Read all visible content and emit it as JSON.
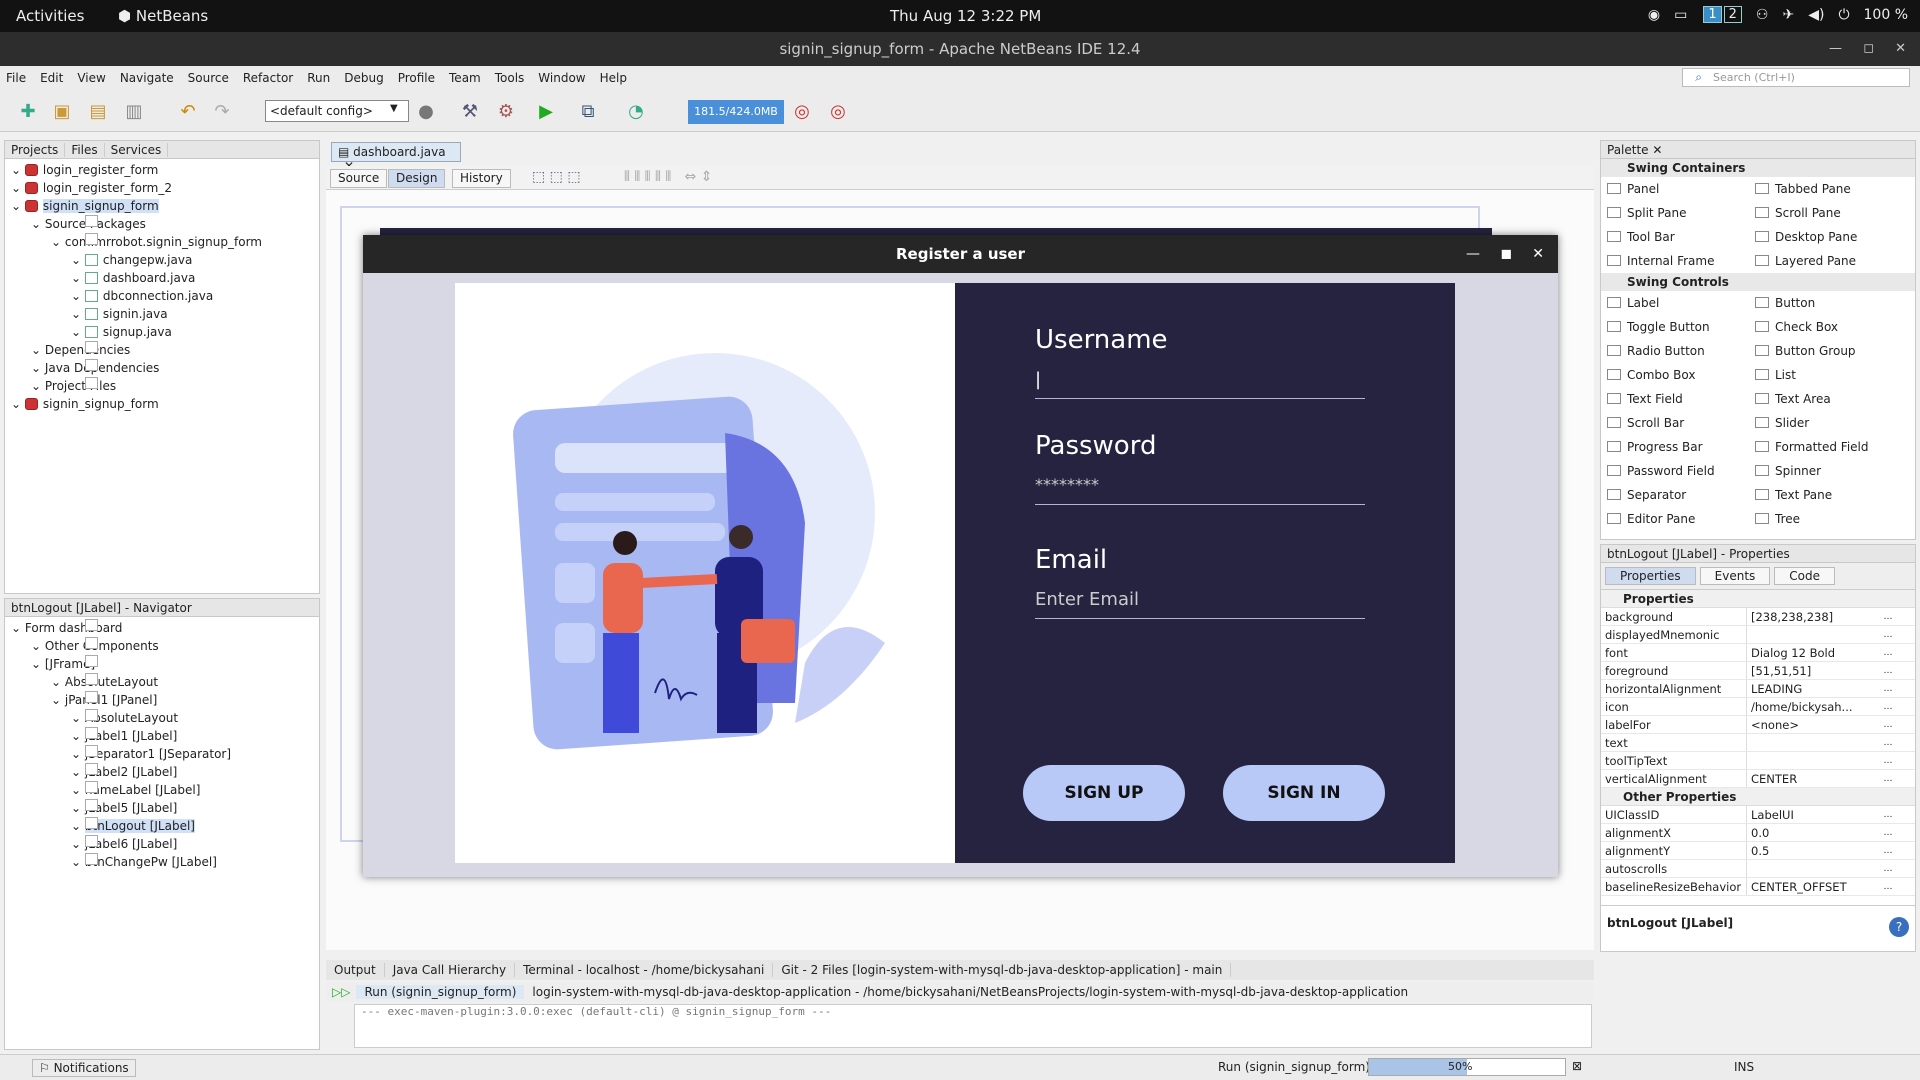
{
  "topbar": {
    "activities": "Activities",
    "app": "NetBeans",
    "clock": "Thu Aug 12   3:22 PM",
    "ws1": "1",
    "ws2": "2",
    "battery": "100 %"
  },
  "window": {
    "title": "signin_signup_form - Apache NetBeans IDE 12.4"
  },
  "menu": [
    "File",
    "Edit",
    "View",
    "Navigate",
    "Source",
    "Refactor",
    "Run",
    "Debug",
    "Profile",
    "Team",
    "Tools",
    "Window",
    "Help"
  ],
  "search": {
    "placeholder": "Search (Ctrl+I)"
  },
  "toolbar": {
    "config": "<default config>",
    "memory": "181.5/424.0MB"
  },
  "projects": {
    "tabs": [
      "Projects",
      "Files",
      "Services"
    ],
    "tree": [
      {
        "label": "login_register_form",
        "depth": 0,
        "icon": "proj"
      },
      {
        "label": "login_register_form_2",
        "depth": 0,
        "icon": "proj"
      },
      {
        "label": "signin_signup_form",
        "depth": 0,
        "icon": "proj",
        "selected": true
      },
      {
        "label": "Source Packages",
        "depth": 1,
        "icon": "pkg"
      },
      {
        "label": "com.mrrobot.signin_signup_form",
        "depth": 2,
        "icon": "pkg"
      },
      {
        "label": "changepw.java",
        "depth": 3,
        "icon": "java"
      },
      {
        "label": "dashboard.java",
        "depth": 3,
        "icon": "java"
      },
      {
        "label": "dbconnection.java",
        "depth": 3,
        "icon": "java"
      },
      {
        "label": "signin.java",
        "depth": 3,
        "icon": "java"
      },
      {
        "label": "signup.java",
        "depth": 3,
        "icon": "java"
      },
      {
        "label": "Dependencies",
        "depth": 1,
        "icon": "pkg"
      },
      {
        "label": "Java Dependencies",
        "depth": 1,
        "icon": "pkg"
      },
      {
        "label": "Project Files",
        "depth": 1,
        "icon": "pkg"
      },
      {
        "label": "signin_signup_form",
        "depth": 0,
        "icon": "proj"
      }
    ]
  },
  "navigator": {
    "title": "btnLogout [JLabel] - Navigator",
    "tree": [
      {
        "label": "Form dashboard",
        "depth": 0
      },
      {
        "label": "Other Components",
        "depth": 1
      },
      {
        "label": "[JFrame]",
        "depth": 1
      },
      {
        "label": "AbsoluteLayout",
        "depth": 2
      },
      {
        "label": "jPanel1 [JPanel]",
        "depth": 2
      },
      {
        "label": "AbsoluteLayout",
        "depth": 3
      },
      {
        "label": "jLabel1 [JLabel]",
        "depth": 3
      },
      {
        "label": "jSeparator1 [JSeparator]",
        "depth": 3
      },
      {
        "label": "jLabel2 [JLabel]",
        "depth": 3
      },
      {
        "label": "nameLabel [JLabel]",
        "depth": 3
      },
      {
        "label": "jLabel5 [JLabel]",
        "depth": 3
      },
      {
        "label": "btnLogout [JLabel]",
        "depth": 3,
        "selected": true
      },
      {
        "label": "jLabel6 [JLabel]",
        "depth": 3
      },
      {
        "label": "btnChangePw [JLabel]",
        "depth": 3
      }
    ]
  },
  "editor": {
    "tab": "dashboard.java",
    "views": [
      "Source",
      "Design",
      "History"
    ]
  },
  "form": {
    "title": "Register a user",
    "username_label": "Username",
    "username_value": "",
    "password_label": "Password",
    "password_value": "********",
    "email_label": "Email",
    "email_placeholder": "Enter Email",
    "signup": "SIGN UP",
    "signin": "SIGN IN"
  },
  "palette": {
    "title": "Palette",
    "containers_title": "Swing Containers",
    "containers": [
      "Panel",
      "Tabbed Pane",
      "Split Pane",
      "Scroll Pane",
      "Tool Bar",
      "Desktop Pane",
      "Internal Frame",
      "Layered Pane"
    ],
    "controls_title": "Swing Controls",
    "controls": [
      "Label",
      "Button",
      "Toggle Button",
      "Check Box",
      "Radio Button",
      "Button Group",
      "Combo Box",
      "List",
      "Text Field",
      "Text Area",
      "Scroll Bar",
      "Slider",
      "Progress Bar",
      "Formatted Field",
      "Password Field",
      "Spinner",
      "Separator",
      "Text Pane",
      "Editor Pane",
      "Tree"
    ]
  },
  "properties": {
    "title": "btnLogout [JLabel] - Properties",
    "tabs": [
      "Properties",
      "Events",
      "Code"
    ],
    "section1": "Properties",
    "rows": [
      {
        "k": "background",
        "v": "[238,238,238]"
      },
      {
        "k": "displayedMnemonic",
        "v": ""
      },
      {
        "k": "font",
        "v": "Dialog 12 Bold"
      },
      {
        "k": "foreground",
        "v": "[51,51,51]"
      },
      {
        "k": "horizontalAlignment",
        "v": "LEADING"
      },
      {
        "k": "icon",
        "v": "/home/bickysah..."
      },
      {
        "k": "labelFor",
        "v": "<none>"
      },
      {
        "k": "text",
        "v": ""
      },
      {
        "k": "toolTipText",
        "v": ""
      },
      {
        "k": "verticalAlignment",
        "v": "CENTER"
      }
    ],
    "section2": "Other Properties",
    "rows2": [
      {
        "k": "UIClassID",
        "v": "LabelUI"
      },
      {
        "k": "alignmentX",
        "v": "0.0"
      },
      {
        "k": "alignmentY",
        "v": "0.5"
      },
      {
        "k": "autoscrolls",
        "v": ""
      },
      {
        "k": "baselineResizeBehavior",
        "v": "CENTER_OFFSET"
      }
    ],
    "footer": "btnLogout [JLabel]"
  },
  "output": {
    "tabs": [
      "Output",
      "Java Call Hierarchy",
      "Terminal - localhost - /home/bickysahani",
      "Git - 2 Files [login-system-with-mysql-db-java-desktop-application] - main"
    ],
    "run_tab": "Run (signin_signup_form)",
    "path_tab": "login-system-with-mysql-db-java-desktop-application - /home/bickysahani/NetBeansProjects/login-system-with-mysql-db-java-desktop-application",
    "line": "--- exec-maven-plugin:3.0.0:exec (default-cli) @ signin_signup_form ---"
  },
  "status": {
    "notifications": "Notifications",
    "run": "Run (signin_signup_form)",
    "progress": "50%",
    "progress_value": 0.5,
    "ins": "INS"
  }
}
